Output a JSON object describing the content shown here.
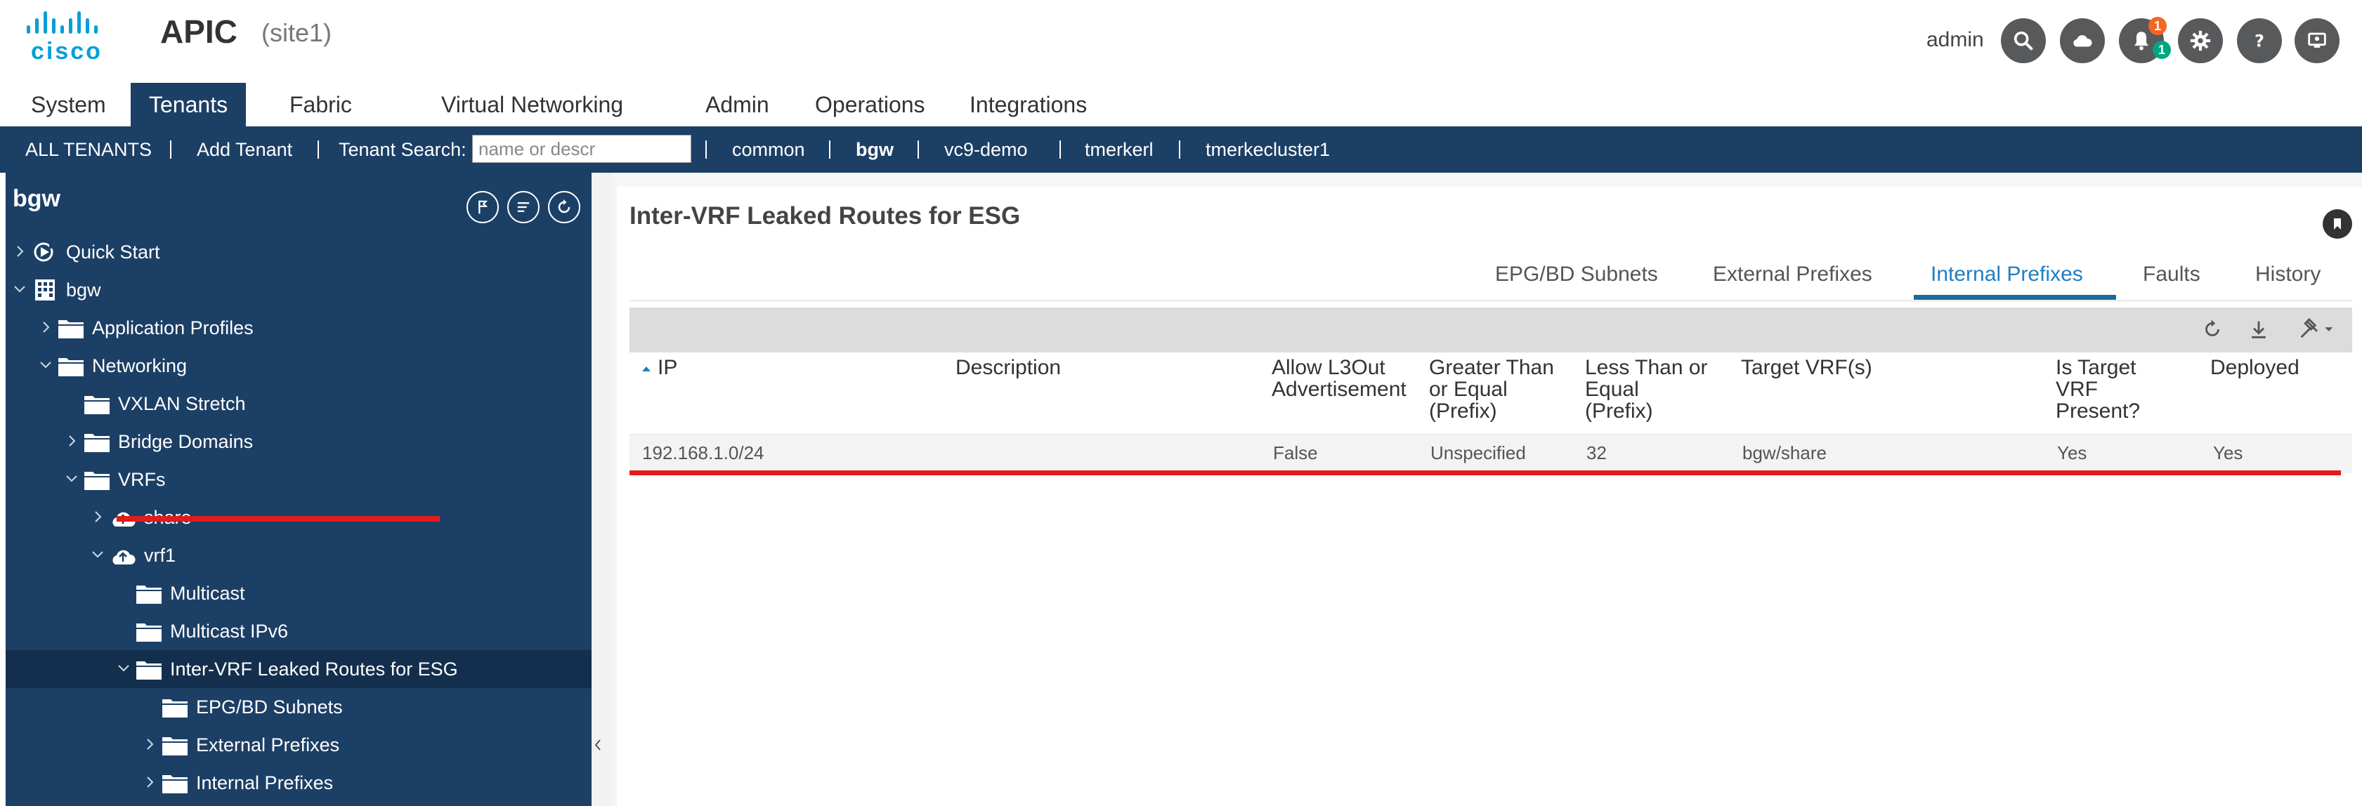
{
  "header": {
    "logo_text": "cisco",
    "app_name": "APIC",
    "site": "(site1)",
    "user": "admin",
    "notifications": {
      "orange_count": "1",
      "green_count": "1"
    },
    "icons": [
      "search-icon",
      "cloud-icon",
      "bell-icon",
      "gear-icon",
      "help-icon",
      "screen-icon"
    ]
  },
  "main_tabs": [
    {
      "label": "System"
    },
    {
      "label": "Tenants",
      "active": true
    },
    {
      "label": "Fabric"
    },
    {
      "label": "Virtual Networking"
    },
    {
      "label": "Admin"
    },
    {
      "label": "Operations"
    },
    {
      "label": "Integrations"
    }
  ],
  "subnav": {
    "all_tenants": "ALL TENANTS",
    "add_tenant": "Add Tenant",
    "search_label": "Tenant Search:",
    "search_placeholder": "name or descr",
    "tenants": [
      "common",
      "bgw",
      "vc9-demo",
      "tmerkerl",
      "tmerkecluster1"
    ],
    "active_tenant": "bgw"
  },
  "tree": {
    "title": "bgw",
    "items": [
      {
        "label": "Quick Start",
        "icon": "quick-start-icon",
        "depth": 0,
        "chevron": "right"
      },
      {
        "label": "bgw",
        "icon": "tenant-grid-icon",
        "depth": 0,
        "chevron": "down"
      },
      {
        "label": "Application Profiles",
        "icon": "folder-icon",
        "depth": 1,
        "chevron": "right"
      },
      {
        "label": "Networking",
        "icon": "folder-icon",
        "depth": 1,
        "chevron": "down"
      },
      {
        "label": "VXLAN Stretch",
        "icon": "folder-icon",
        "depth": 2,
        "chevron": "none"
      },
      {
        "label": "Bridge Domains",
        "icon": "folder-icon",
        "depth": 2,
        "chevron": "right"
      },
      {
        "label": "VRFs",
        "icon": "folder-icon",
        "depth": 2,
        "chevron": "down"
      },
      {
        "label": "share",
        "icon": "vrf-cloud-icon",
        "depth": 3,
        "chevron": "right"
      },
      {
        "label": "vrf1",
        "icon": "vrf-cloud-icon",
        "depth": 3,
        "chevron": "down"
      },
      {
        "label": "Multicast",
        "icon": "folder-icon",
        "depth": 4,
        "chevron": "none"
      },
      {
        "label": "Multicast IPv6",
        "icon": "folder-icon",
        "depth": 4,
        "chevron": "none"
      },
      {
        "label": "Inter-VRF Leaked Routes for ESG",
        "icon": "folder-icon",
        "depth": 4,
        "chevron": "down",
        "selected": true
      },
      {
        "label": "EPG/BD Subnets",
        "icon": "folder-icon",
        "depth": 5,
        "chevron": "none"
      },
      {
        "label": "External Prefixes",
        "icon": "folder-icon",
        "depth": 5,
        "chevron": "right"
      },
      {
        "label": "Internal Prefixes",
        "icon": "folder-icon",
        "depth": 5,
        "chevron": "right"
      }
    ]
  },
  "content": {
    "title": "Inter-VRF Leaked Routes for ESG",
    "subtabs": [
      {
        "label": "EPG/BD Subnets"
      },
      {
        "label": "External Prefixes"
      },
      {
        "label": "Internal Prefixes",
        "active": true
      },
      {
        "label": "Faults"
      },
      {
        "label": "History"
      }
    ],
    "table": {
      "columns": [
        {
          "label": "IP",
          "sorted": "asc"
        },
        {
          "label": "Description"
        },
        {
          "label": "Allow L3Out\nAdvertisement"
        },
        {
          "label": "Greater Than\nor Equal\n(Prefix)"
        },
        {
          "label": "Less Than or\nEqual\n(Prefix)"
        },
        {
          "label": "Target VRF(s)"
        },
        {
          "label": "Is Target\nVRF\nPresent?"
        },
        {
          "label": "Deployed"
        }
      ],
      "rows": [
        [
          "192.168.1.0/24",
          "",
          "False",
          "Unspecified",
          "32",
          "bgw/share",
          "Yes",
          "Yes"
        ]
      ]
    }
  },
  "colors": {
    "nav_blue": "#1c3f65",
    "selected_row": "#142f4d",
    "active_tab_blue": "#1f7fc1",
    "annotation_red": "#e21b1b",
    "cisco_blue": "#049fd9",
    "notify_orange": "#f26722",
    "notify_green": "#00a67e"
  }
}
